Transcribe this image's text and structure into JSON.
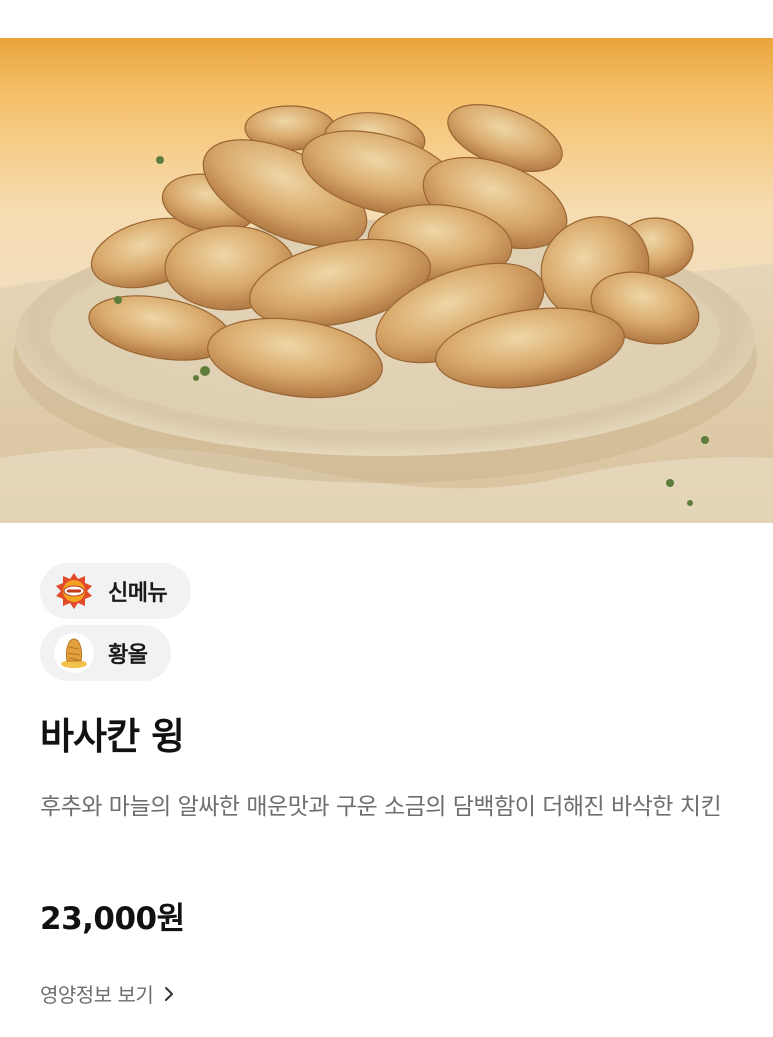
{
  "product": {
    "image_subject": "chicken-wings-on-plate",
    "badges": [
      {
        "label": "신메뉴",
        "icon": "bbq-logo-icon"
      },
      {
        "label": "황올",
        "icon": "golden-chicken-icon"
      }
    ],
    "title": "바사칸 윙",
    "description": "후추와 마늘의 알싸한 매운맛과 구운 소금의 담백함이 더해진 바삭한 치킨",
    "price": "23,000원",
    "nutrition_link": "영양정보 보기"
  },
  "colors": {
    "badge_bg": "#f1f2f4",
    "text_primary": "#111111",
    "text_secondary": "#6e6e6e"
  }
}
